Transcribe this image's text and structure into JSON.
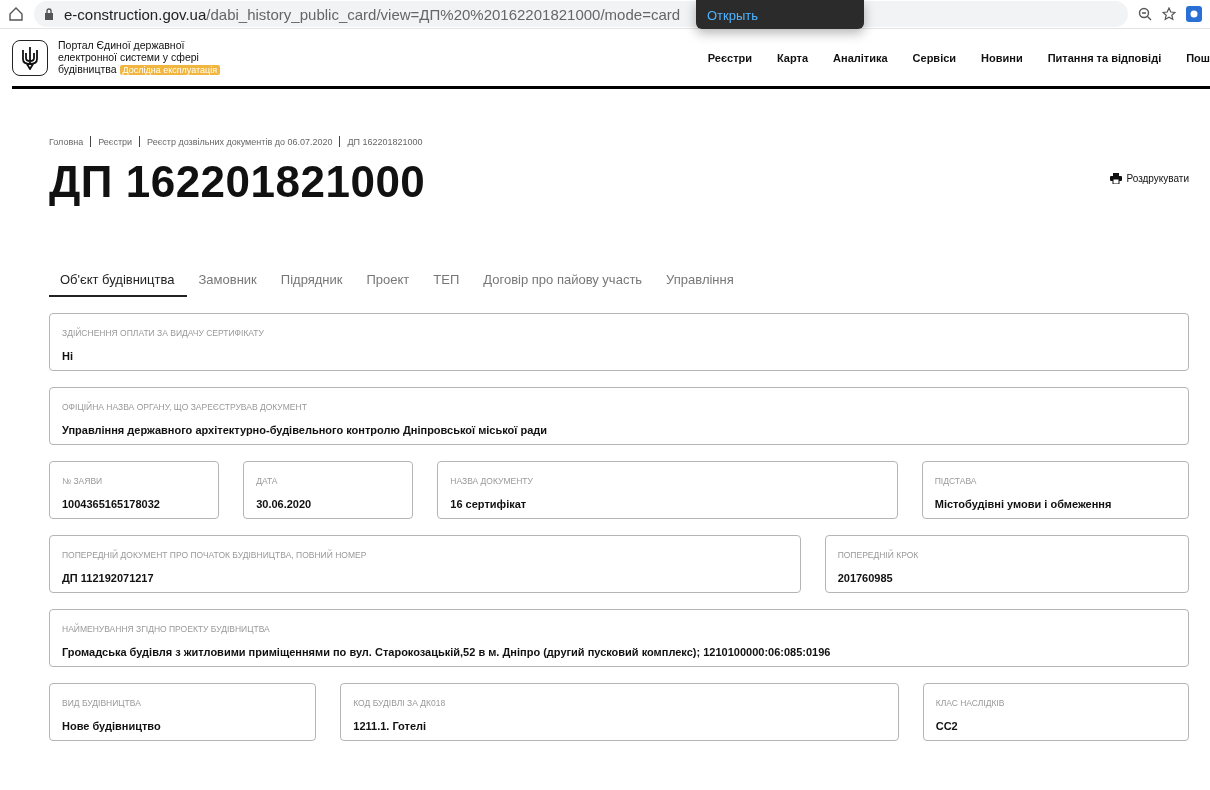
{
  "browser": {
    "url_host": "e-construction.gov.ua",
    "url_path": "/dabi_history_public_card/view=ДП%20%20162201821000/mode=card",
    "tooltip_action": "Открыть"
  },
  "header": {
    "title_lines": [
      "Портал Єдиної державної",
      "електронної системи у сфері",
      "будівництва"
    ],
    "badge": "Дослідна експлуатація",
    "nav": [
      "Реєстри",
      "Карта",
      "Аналітика",
      "Сервіси",
      "Новини",
      "Питання та відповіді",
      "Пош"
    ]
  },
  "breadcrumbs": [
    "Головна",
    "Реєстри",
    "Реєстр дозвільних документів до 06.07.2020",
    "ДП 162201821000"
  ],
  "title": "ДП 162201821000",
  "print_button": "Роздрукувати",
  "tabs": [
    {
      "label": "Об'єкт будівництва",
      "selected": true
    },
    {
      "label": "Замовник",
      "selected": false
    },
    {
      "label": "Підрядник",
      "selected": false
    },
    {
      "label": "Проект",
      "selected": false
    },
    {
      "label": "ТЕП",
      "selected": false
    },
    {
      "label": "Договір про пайову участь",
      "selected": false
    },
    {
      "label": "Управління",
      "selected": false
    }
  ],
  "rows": [
    [
      {
        "label": "ЗДІЙСНЕННЯ ОПЛАТИ ЗА ВИДАЧУ СЕРТИФІКАТУ",
        "value": "Ні"
      }
    ],
    [
      {
        "label": "ОФІЦІЙНА НАЗВА ОРГАНУ, ЩО ЗАРЕЄСТРУВАВ ДОКУМЕНТ",
        "value": "Управління державного архітектурно-будівельного контролю Дніпровської міської ради"
      }
    ],
    [
      {
        "label": "№ ЗАЯВИ",
        "value": "1004365165178032"
      },
      {
        "label": "ДАТА",
        "value": "30.06.2020"
      },
      {
        "label": "НАЗВА ДОКУМЕНТУ",
        "value": "16 сертифікат"
      },
      {
        "label": "ПІДСТАВА",
        "value": "Містобудівні умови і обмеження"
      }
    ],
    [
      {
        "label": "ПОПЕРЕДНІЙ ДОКУМЕНТ ПРО ПОЧАТОК БУДІВНИЦТВА, ПОВНИЙ НОМЕР",
        "value": "ДП 112192071217"
      },
      {
        "label": "ПОПЕРЕДНІЙ КРОК",
        "value": "201760985"
      }
    ],
    [
      {
        "label": "НАЙМЕНУВАННЯ ЗГІДНО ПРОЕКТУ БУДІВНИЦТВА",
        "value": "Громадська будівля з житловими приміщеннями по вул. Старокозацькій,52 в м. Дніпро (другий пусковий комплекс); 1210100000:06:085:0196"
      }
    ],
    [
      {
        "label": "ВИД БУДІВНИЦТВА",
        "value": "Нове будівництво"
      },
      {
        "label": "КОД БУДІВЛІ ЗА ДК018",
        "value": "1211.1. Готелі"
      },
      {
        "label": "КЛАС НАСЛІДКІВ",
        "value": "СС2"
      }
    ]
  ]
}
